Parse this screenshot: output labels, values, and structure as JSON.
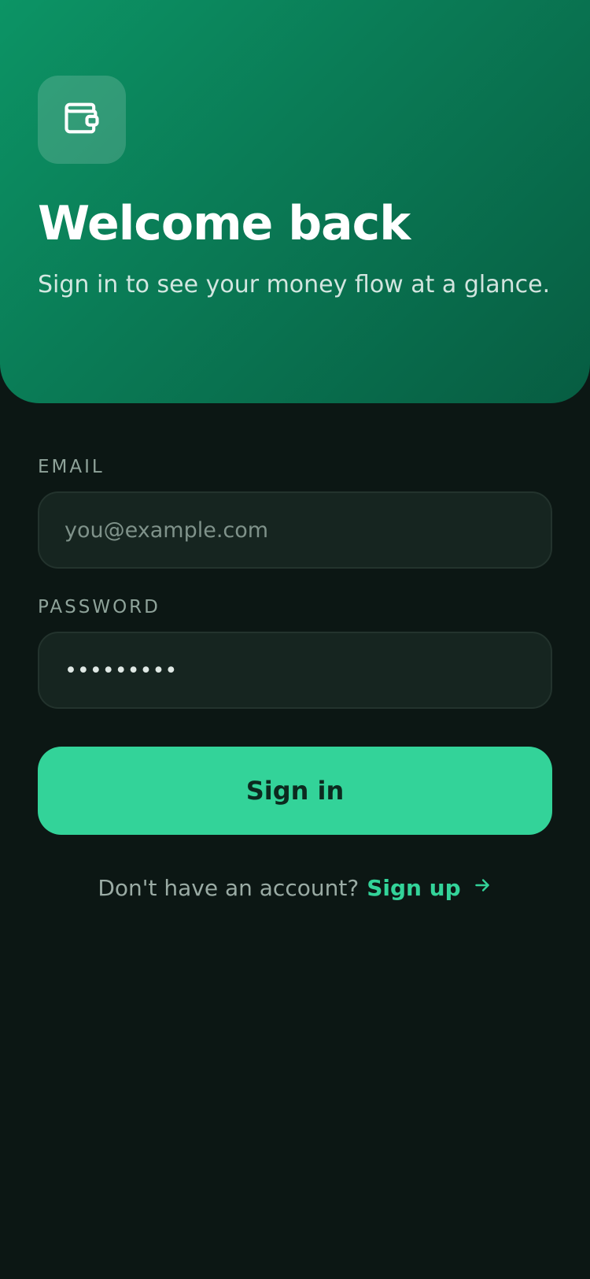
{
  "hero": {
    "icon": "wallet-icon",
    "title": "Welcome back",
    "subtitle": "Sign in to see your money flow at a glance."
  },
  "form": {
    "email": {
      "label": "EMAIL",
      "placeholder": "you@example.com",
      "value": ""
    },
    "password": {
      "label": "PASSWORD",
      "value": "•••••••••"
    },
    "submit_label": "Sign in"
  },
  "footer": {
    "prompt": "Don't have an account?",
    "link_label": "Sign up",
    "link_icon": "arrow-right-icon"
  },
  "colors": {
    "accent": "#33d399",
    "background": "#0c1714",
    "hero_start": "#0c9465",
    "hero_end": "#075d42",
    "field_bg": "#162520"
  }
}
